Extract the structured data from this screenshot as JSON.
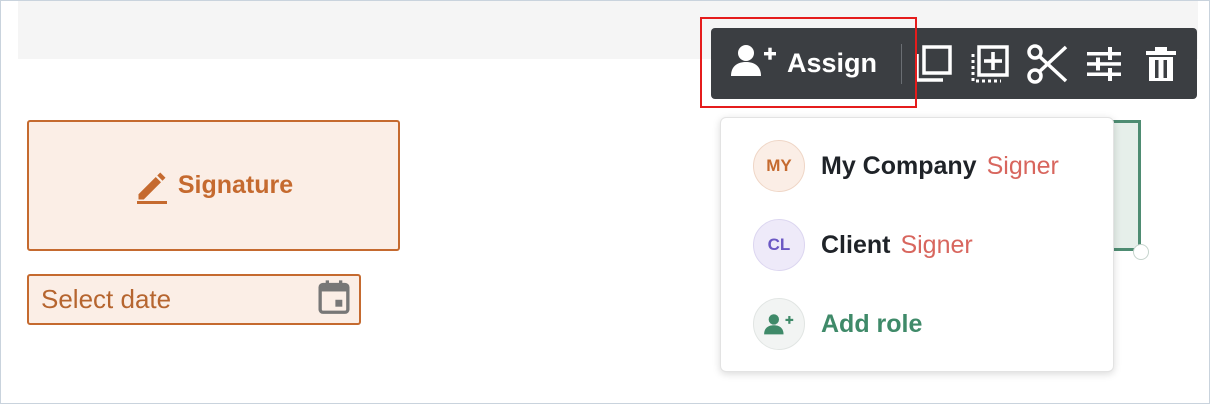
{
  "fields": {
    "signature_label": "Signature",
    "date_placeholder": "Select date"
  },
  "toolbar": {
    "assign_label": "Assign",
    "icons": [
      "duplicate-icon",
      "select-area-icon",
      "cut-icon",
      "adjust-icon",
      "delete-icon"
    ]
  },
  "dropdown": {
    "roles": [
      {
        "initials": "MY",
        "name": "My Company",
        "type": "Signer"
      },
      {
        "initials": "CL",
        "name": "Client",
        "type": "Signer"
      }
    ],
    "add_role_label": "Add role"
  },
  "colors": {
    "field_accent": "#c56a2f",
    "field_bg": "#fbeee6",
    "toolbar_bg": "#3b3e42",
    "signer_text": "#d8665e",
    "add_role_green": "#3f8a69",
    "highlight_red": "#e51c1c"
  }
}
